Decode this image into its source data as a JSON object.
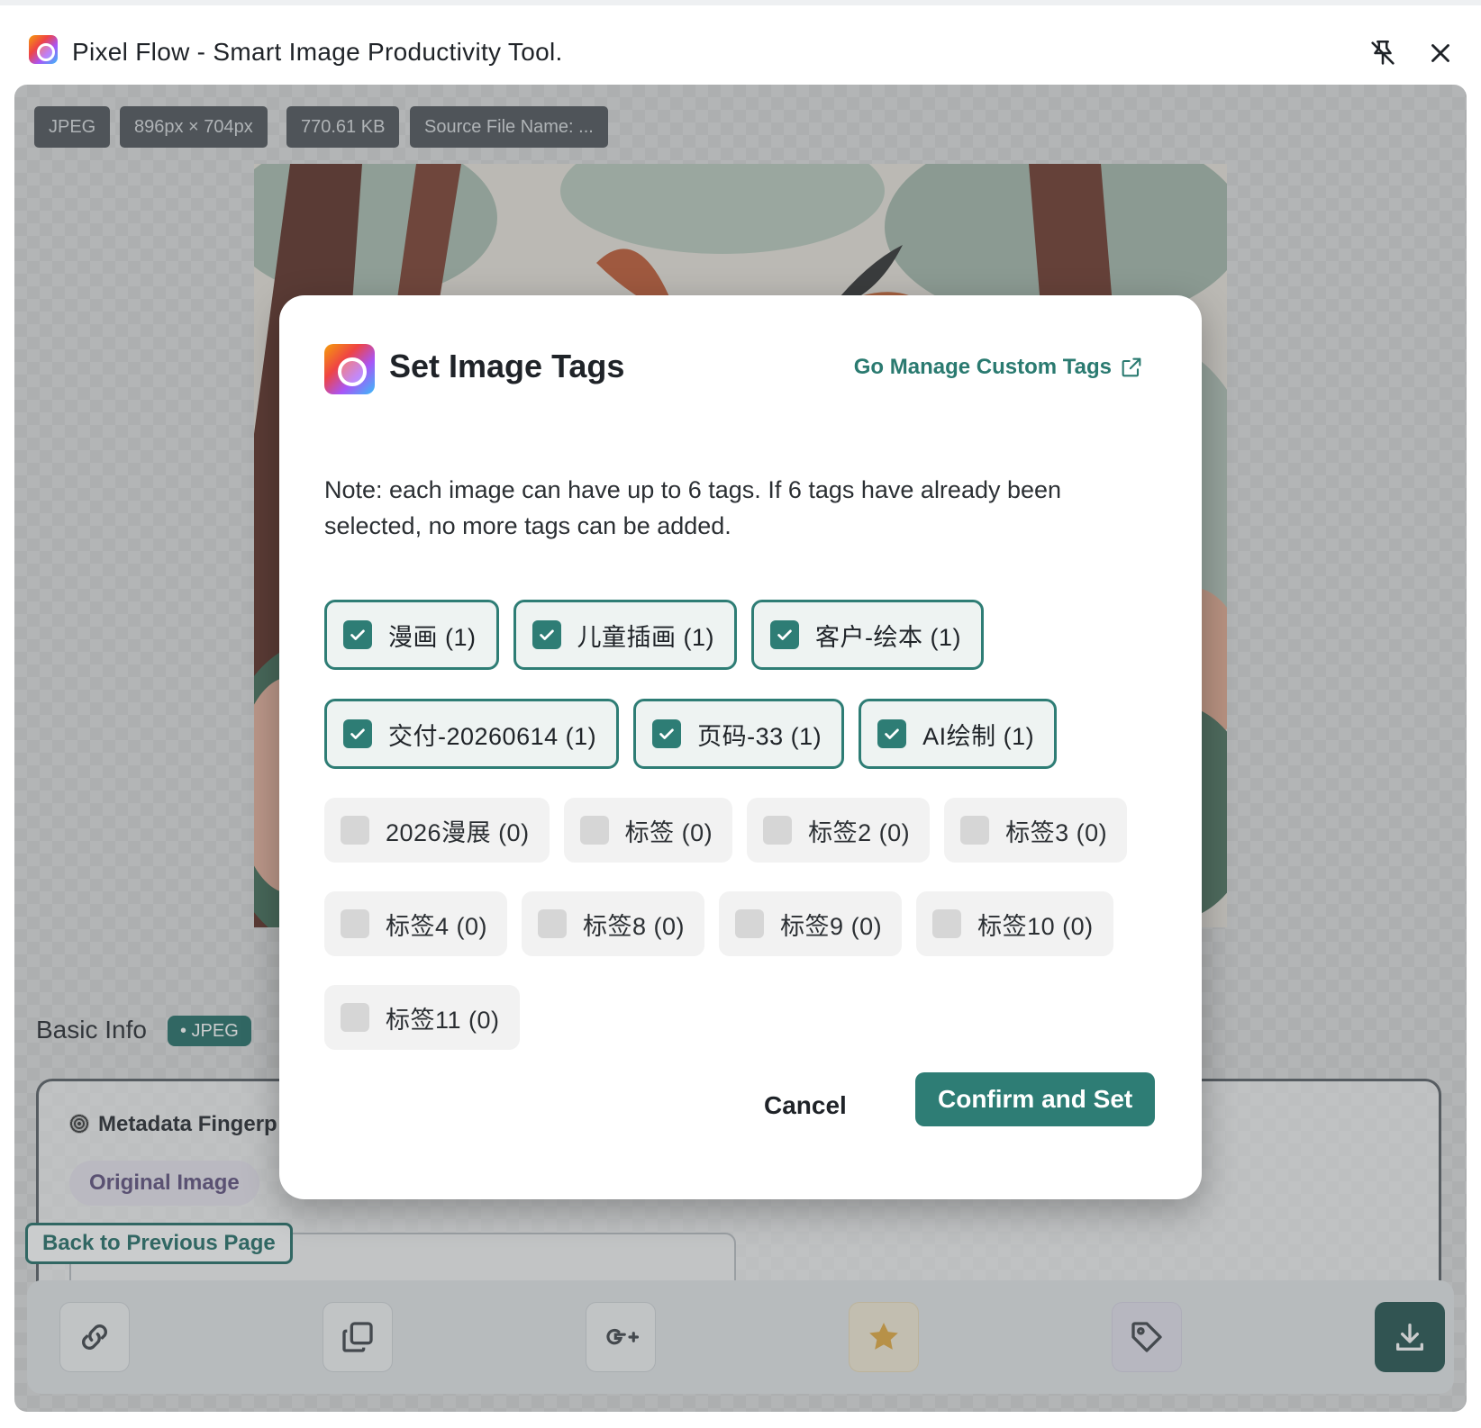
{
  "window": {
    "title": "Pixel Flow - Smart Image Productivity Tool."
  },
  "image_info": {
    "format": "JPEG",
    "dimensions": "896px × 704px",
    "file_size": "770.61 KB",
    "source_file_name": "Source File Name: ..."
  },
  "basic_info": {
    "label": "Basic Info",
    "format_badge": "• JPEG"
  },
  "metadata": {
    "title": "Metadata Fingerp",
    "original_pill": "Original Image"
  },
  "back_button": "Back to Previous Page",
  "modal": {
    "title": "Set Image Tags",
    "manage_link": "Go Manage Custom Tags",
    "note": "Note: each image can have up to 6 tags. If 6 tags have already been selected, no more tags can be added.",
    "tags": [
      {
        "label": "漫画 (1)",
        "checked": true
      },
      {
        "label": "儿童插画 (1)",
        "checked": true
      },
      {
        "label": "客户-绘本 (1)",
        "checked": true
      },
      {
        "label": "交付-20260614 (1)",
        "checked": true
      },
      {
        "label": "页码-33 (1)",
        "checked": true
      },
      {
        "label": "AI绘制 (1)",
        "checked": true
      },
      {
        "label": "2026漫展 (0)",
        "checked": false
      },
      {
        "label": "标签 (0)",
        "checked": false
      },
      {
        "label": "标签2 (0)",
        "checked": false
      },
      {
        "label": "标签3 (0)",
        "checked": false
      },
      {
        "label": "标签4 (0)",
        "checked": false
      },
      {
        "label": "标签8 (0)",
        "checked": false
      },
      {
        "label": "标签9 (0)",
        "checked": false
      },
      {
        "label": "标签10 (0)",
        "checked": false
      },
      {
        "label": "标签11 (0)",
        "checked": false
      }
    ],
    "cancel_label": "Cancel",
    "confirm_label": "Confirm and Set"
  },
  "bottom_actions": [
    "link-icon",
    "copy-icon",
    "google-plus-icon",
    "star-icon",
    "tag-icon",
    "download-icon"
  ],
  "colors": {
    "accent": "#2e7d75",
    "accent_dark": "#1e6b63",
    "chip_bg": "#4a4f54"
  }
}
